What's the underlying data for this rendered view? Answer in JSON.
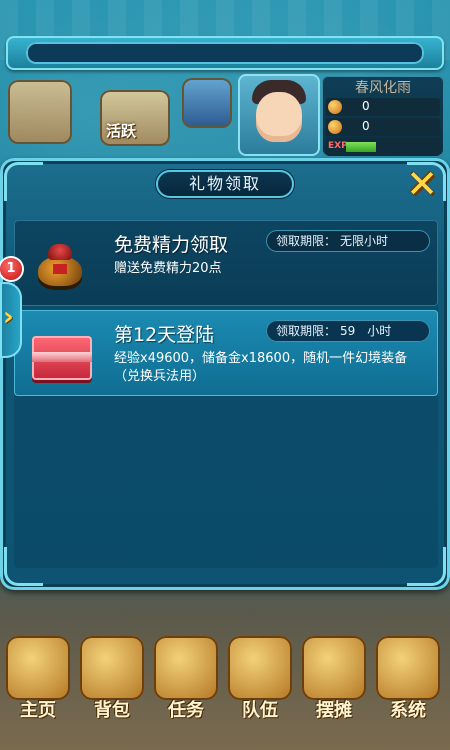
{
  "header": {
    "player_name": "春风化雨",
    "stat1_value": "0",
    "stat2_value": "0",
    "exp_label": "EXP",
    "active_label": "活跃"
  },
  "panel": {
    "title": "礼物领取",
    "close_icon": "close-x-icon"
  },
  "rewards": [
    {
      "name": "免费精力领取",
      "description": "赠送免费精力20点",
      "deadline_label": "领取期限：",
      "deadline_value": "无限小时",
      "icon": "energy-jar-icon"
    },
    {
      "name": "第12天登陆",
      "description": "经验x49600，储备金x18600，随机一件幻境装备（兑换兵法用）",
      "deadline_label": "领取期限：",
      "deadline_value": "59　小时",
      "icon": "gift-chest-icon"
    }
  ],
  "badge_count": "1",
  "bottom_nav": [
    "主页",
    "背包",
    "任务",
    "队伍",
    "摆摊",
    "系统"
  ],
  "colors": {
    "panel_bg": "#0f5876",
    "selected_row": "#1c8bb2",
    "close_yellow": "#ffd84a"
  }
}
